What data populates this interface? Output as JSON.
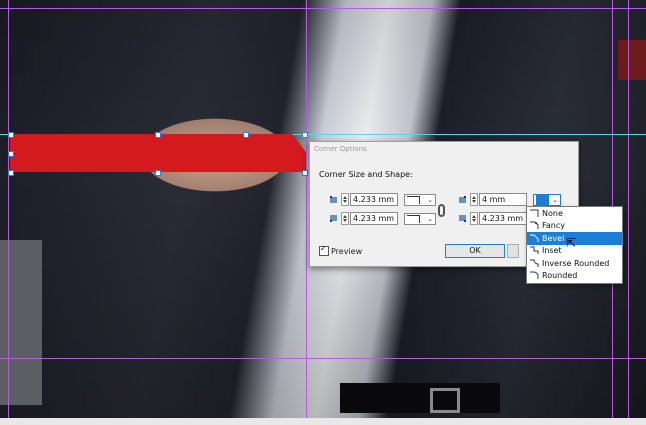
{
  "dialog": {
    "title": "Corner Options",
    "section_label": "Corner Size and Shape:",
    "top_left": {
      "value": "4.233 mm",
      "icon": "corner-top-left-icon"
    },
    "bottom_left": {
      "value": "4.233 mm",
      "icon": "corner-bottom-left-icon"
    },
    "top_right": {
      "value": "4 mm",
      "icon": "corner-top-right-icon"
    },
    "bottom_right": {
      "value": "4.233 mm",
      "icon": "corner-bottom-right-icon"
    },
    "preview_label": "Preview",
    "preview_checked": true,
    "ok_label": "OK"
  },
  "shape_menu": {
    "options": [
      "None",
      "Fancy",
      "Bevel",
      "Inset",
      "Inverse Rounded",
      "Rounded"
    ],
    "selected": "Bevel"
  },
  "colors": {
    "frame_fill": "#d31a1d",
    "guide": "#b060d8",
    "selection_blue": "#1b7fd8"
  }
}
